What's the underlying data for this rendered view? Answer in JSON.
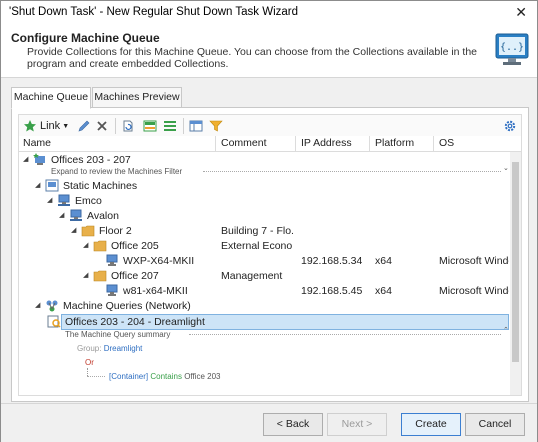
{
  "window": {
    "title": "'Shut Down Task' - New Regular Shut Down Task Wizard"
  },
  "header": {
    "title": "Configure Machine Queue",
    "description": "Provide Collections for this Machine Queue. You can choose from the Collections available in the program and create embedded Collections."
  },
  "tabs": [
    {
      "label": "Machine Queue",
      "active": true
    },
    {
      "label": "Machines Preview",
      "active": false
    }
  ],
  "toolbar": {
    "link_label": "Link"
  },
  "columns": [
    "Name",
    "Comment",
    "IP Address",
    "Platform",
    "OS"
  ],
  "tree": {
    "root": {
      "name": "Offices 203 - 207",
      "hint": "Expand to review the Machines Filter"
    },
    "static_machines": "Static Machines",
    "emco": "Emco",
    "avalon": "Avalon",
    "floor2": {
      "name": "Floor 2",
      "comment": "Building 7 - Flo..."
    },
    "office205": {
      "name": "Office 205",
      "comment": "External Econo..."
    },
    "wxp": {
      "name": "WXP-X64-MKII",
      "ip": "192.168.5.34",
      "platform": "x64",
      "os": "Microsoft Window"
    },
    "office207": {
      "name": "Office 207",
      "comment": "Management"
    },
    "w81": {
      "name": "w81-x64-MKII",
      "ip": "192.168.5.45",
      "platform": "x64",
      "os": "Microsoft Window"
    },
    "queries": "Machine Queries (Network)",
    "dreamlight": {
      "name": "Offices 203 - 204 - Dreamlight",
      "summary": "The Machine Query summary"
    },
    "summary_group_label": "Group:",
    "summary_group_value": "Dreamlight",
    "summary_or": "Or",
    "summary_container": "[Container]",
    "summary_contains": "Contains",
    "summary_target": "Office 203"
  },
  "footer": {
    "back": "< Back",
    "next": "Next >",
    "create": "Create",
    "cancel": "Cancel"
  },
  "colors": {
    "selection": "#cde4f7",
    "accent": "#3c7fd1",
    "folder": "#e8b04a",
    "link_blue": "#2f6fc2",
    "or_red": "#c0392b"
  }
}
